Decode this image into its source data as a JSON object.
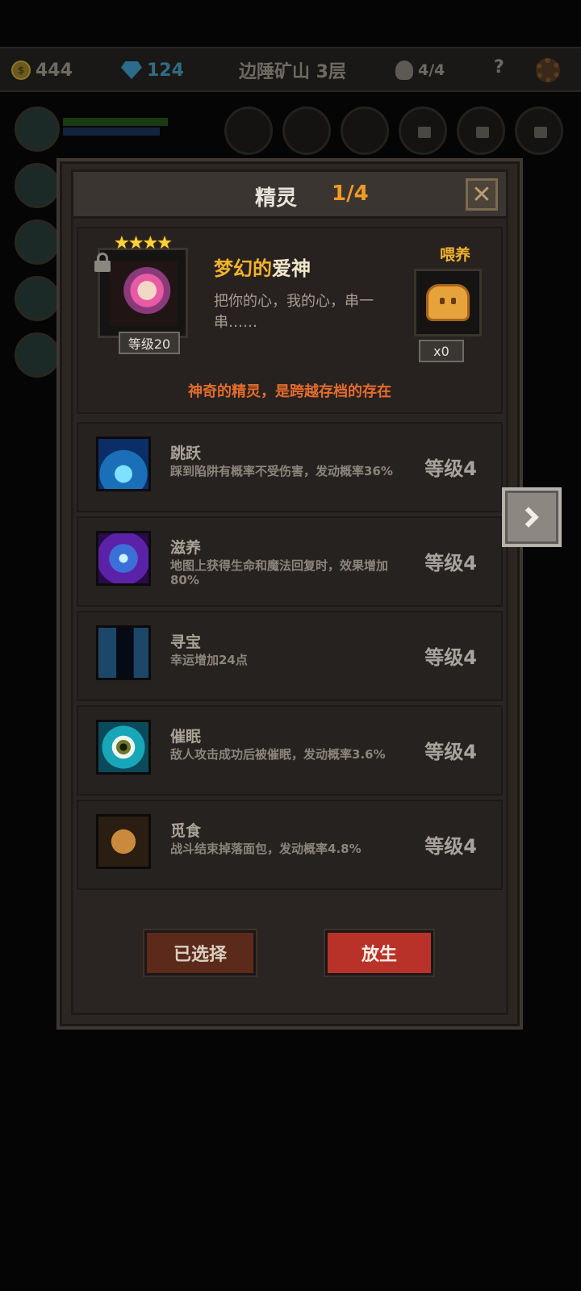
{
  "hud": {
    "gold": "444",
    "gems": "124",
    "location": "边陲矿山 3层",
    "skulls": "4/4",
    "help": "?"
  },
  "dialog": {
    "title": "精灵",
    "count": "1/4",
    "close_label": "✕"
  },
  "sprite": {
    "stars": "★★★★",
    "level": "等级20",
    "name_prefix": "梦幻的",
    "name_suffix": "爱神",
    "description": "把你的心，我的心，串一串……",
    "feed_label": "喂养",
    "feed_count": "x0",
    "note": "神奇的精灵，是跨越存档的存在"
  },
  "skills": [
    {
      "name": "跳跃",
      "description": "踩到陷阱有概率不受伤害，发动概率36%",
      "level": "等级4",
      "icon": "jump-icon"
    },
    {
      "name": "滋养",
      "description": "地图上获得生命和魔法回复时，效果增加80%",
      "level": "等级4",
      "icon": "nourish-icon"
    },
    {
      "name": "寻宝",
      "description": "幸运增加24点",
      "level": "等级4",
      "icon": "treasure-icon"
    },
    {
      "name": "催眠",
      "description": "敌人攻击成功后被催眠，发动概率3.6%",
      "level": "等级4",
      "icon": "hypnosis-icon"
    },
    {
      "name": "觅食",
      "description": "战斗结束掉落面包，发动概率4.8%",
      "level": "等级4",
      "icon": "forage-icon"
    }
  ],
  "buttons": {
    "selected": "已选择",
    "release": "放生"
  },
  "colors": {
    "accent_orange": "#f09b24",
    "note_orange": "#e46c2c",
    "release_red": "#b8322a"
  }
}
